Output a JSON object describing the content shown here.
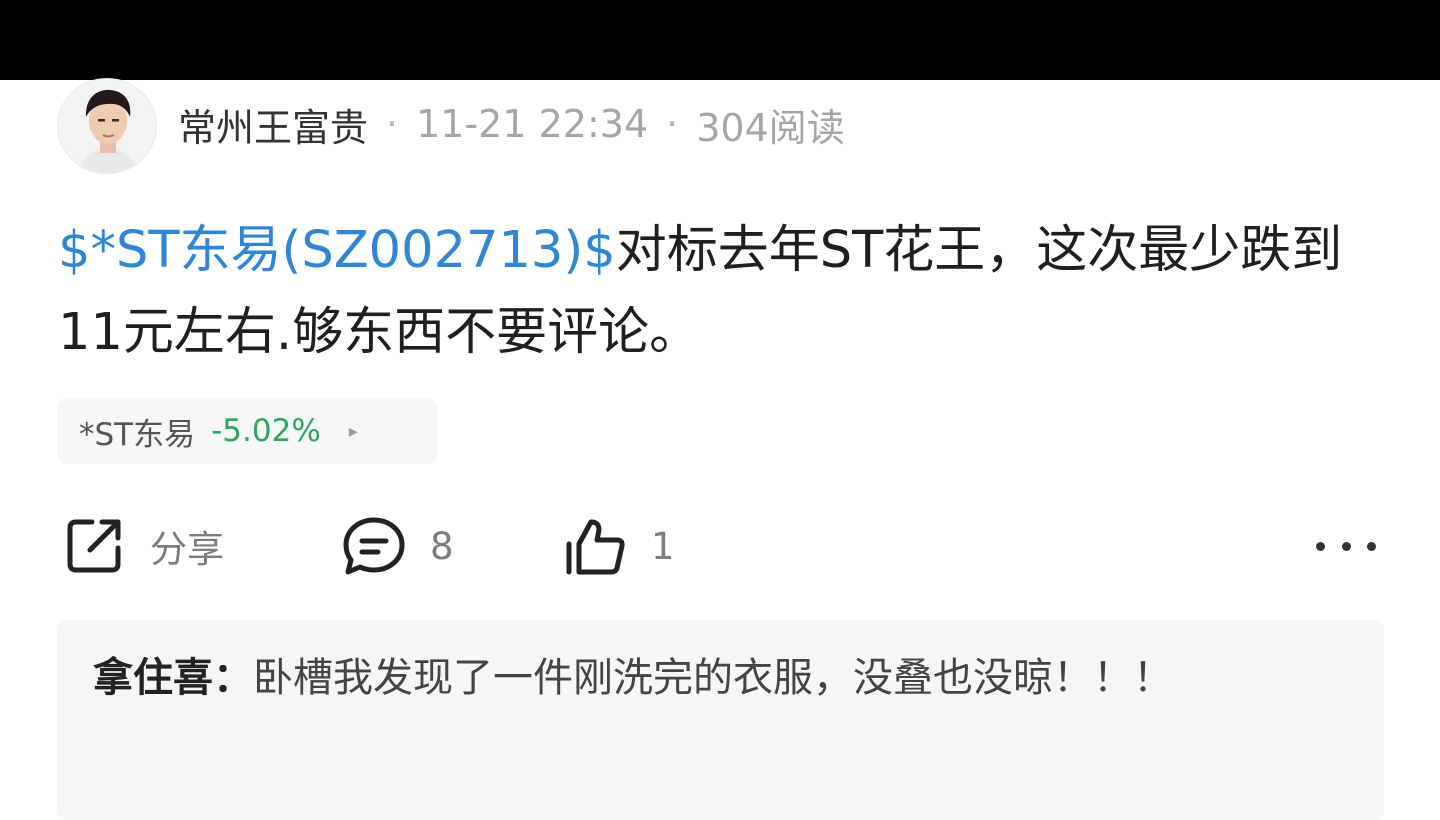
{
  "post": {
    "author": "常州王富贵",
    "separator": "·",
    "date": "11-21 22:34",
    "reads": "304阅读",
    "stock_link": "$*ST东易(SZ002713)$",
    "body": "对标去年ST花王，这次最少跌到11元左右.够东西不要评论。"
  },
  "stock_chip": {
    "name": "*ST东易",
    "change": "-5.02%",
    "arrow": "▸",
    "change_color": "#2ca660"
  },
  "actions": {
    "share_label": "分享",
    "comment_count": "8",
    "like_count": "1",
    "share_icon": "share-icon",
    "comment_icon": "comment-bubble-icon",
    "like_icon": "thumbs-up-icon",
    "more_icon": "more-dots-icon"
  },
  "comment": {
    "author": "拿住喜：",
    "text": "卧槽我发现了一件刚洗完的衣服，没叠也没晾！！！"
  },
  "colors": {
    "link": "#2f86d6",
    "gain_loss": "#2ca660",
    "top_bar": "#000000"
  }
}
